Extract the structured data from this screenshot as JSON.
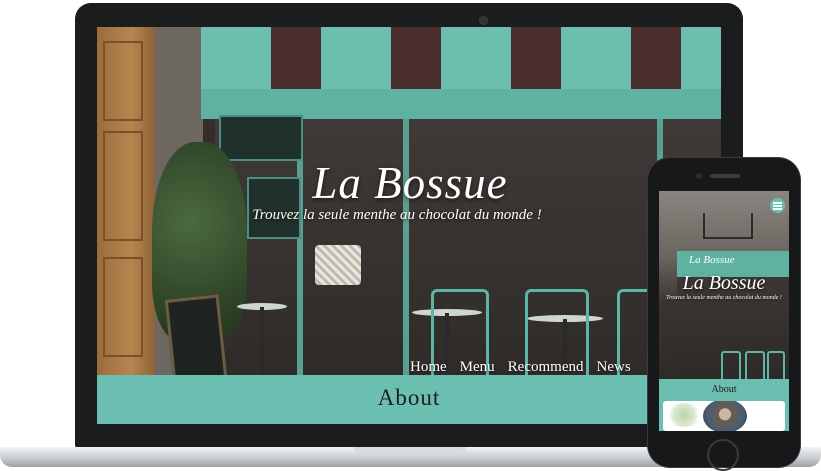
{
  "site": {
    "title": "La Bossue",
    "tagline": "Trouvez la seule menthe au chocolat du monde !"
  },
  "nav": {
    "items": [
      "Home",
      "Menu",
      "Recommend",
      "News"
    ]
  },
  "about": {
    "heading": "About"
  },
  "mobile": {
    "awning_text": "La Bossue",
    "title": "La Bossue",
    "tagline": "Trouvez la seule menthe au chocolat du monde !",
    "about_heading": "About",
    "menu_icon": "hamburger-icon"
  },
  "colors": {
    "accent": "#6bbfb1",
    "awning_dark": "#4a2f2c",
    "device_frame": "#1b1c1e"
  }
}
